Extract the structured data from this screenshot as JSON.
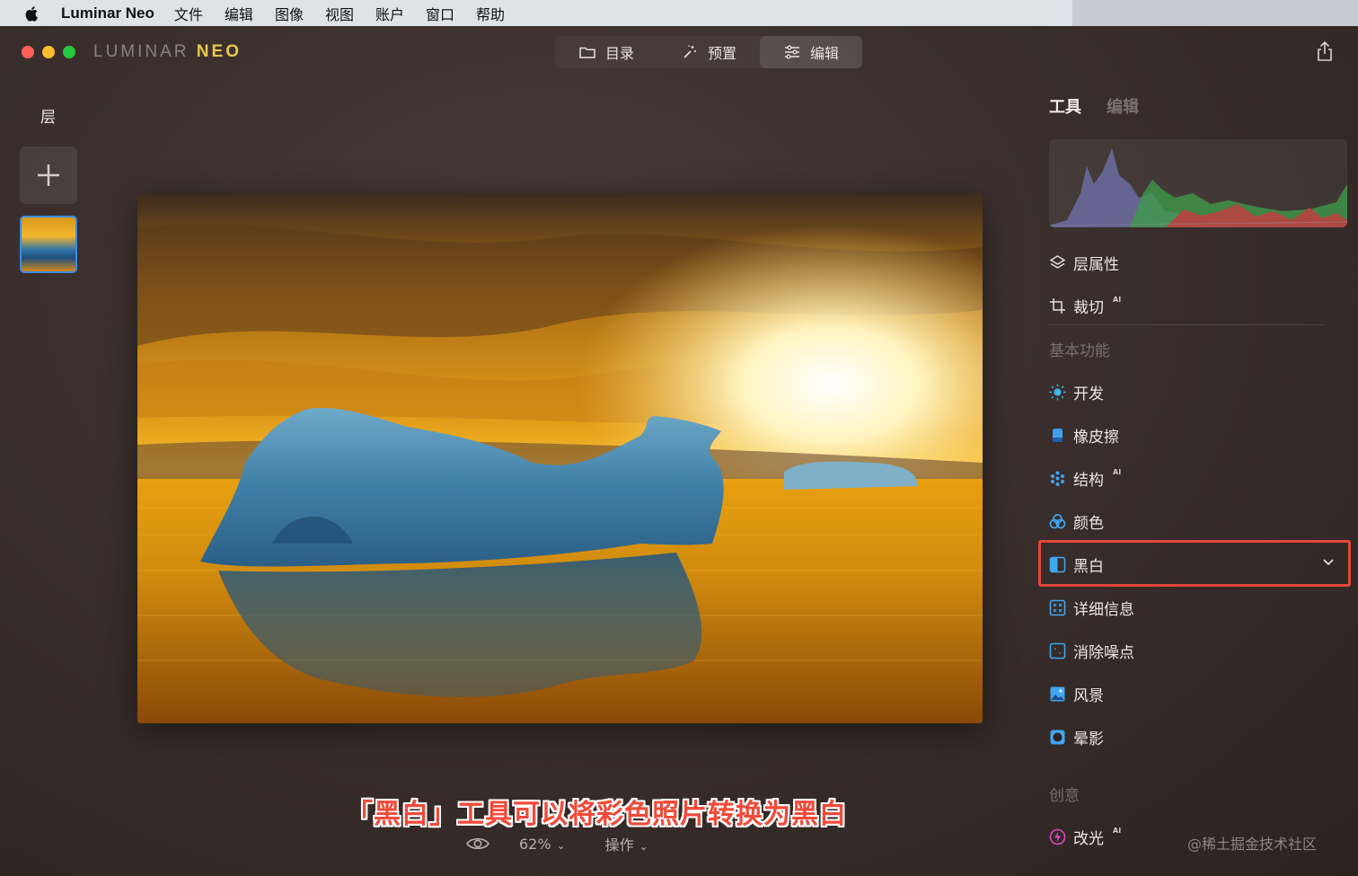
{
  "menubar": {
    "app_name": "Luminar Neo",
    "items": [
      "文件",
      "编辑",
      "图像",
      "视图",
      "账户",
      "窗口",
      "帮助"
    ]
  },
  "window": {
    "logo_main": "LUMINAR",
    "logo_accent": "NEO",
    "nav": [
      {
        "label": "目录",
        "icon": "folder-icon"
      },
      {
        "label": "预置",
        "icon": "magic-wand-icon"
      },
      {
        "label": "编辑",
        "icon": "sliders-icon"
      }
    ],
    "active_tab": "编辑"
  },
  "layers": {
    "title": "层"
  },
  "photo": {
    "subtitle": "「黑白」工具可以将彩色照片转换为黑白"
  },
  "bottombar": {
    "zoom": "62%",
    "actions": "操作"
  },
  "right_panel": {
    "tabs": [
      "工具",
      "编辑"
    ],
    "tools": {
      "layer_props": "层属性",
      "crop": "裁切",
      "ai_badge": "AI",
      "section_basic": "基本功能",
      "develop": "开发",
      "eraser": "橡皮擦",
      "structure": "结构",
      "color": "颜色",
      "bw": "黑白",
      "details": "详细信息",
      "denoise": "消除噪点",
      "landscape": "风景",
      "vignette": "晕影",
      "section_creative": "创意",
      "relight": "改光"
    }
  },
  "watermark": "@稀土掘金技术社区",
  "colors": {
    "selected_outline": "#e4463a",
    "accent_blue": "#3b8be8",
    "logo_yellow": "#e7c84f"
  }
}
